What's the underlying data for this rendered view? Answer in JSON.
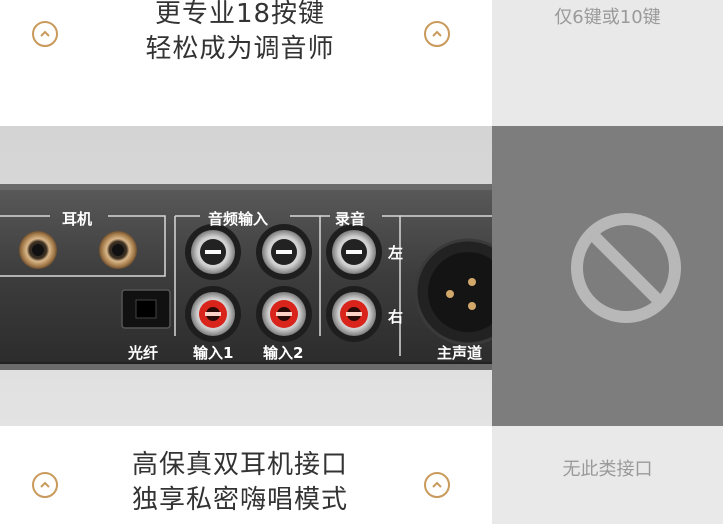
{
  "feature_top": {
    "line1": "更专业18按键",
    "line2": "轻松成为调音师"
  },
  "compare_top": "仅6键或10键",
  "feature_bottom": {
    "line1": "高保真双耳机接口",
    "line2": "独享私密嗨唱模式"
  },
  "compare_bottom": "无此类接口",
  "device_labels": {
    "headphone": "耳机",
    "audio_input": "音频输入",
    "record": "录音",
    "left": "左",
    "right": "右",
    "optical": "光纤",
    "input1": "输入1",
    "input2": "输入2",
    "main_channel": "主声道"
  },
  "colors": {
    "accent": "#c99a5b",
    "comparison_panel": "#7d7d7d",
    "comparison_bg": "#e9e9e9"
  },
  "icons": [
    "chevron-up-icon",
    "prohibited-icon"
  ]
}
